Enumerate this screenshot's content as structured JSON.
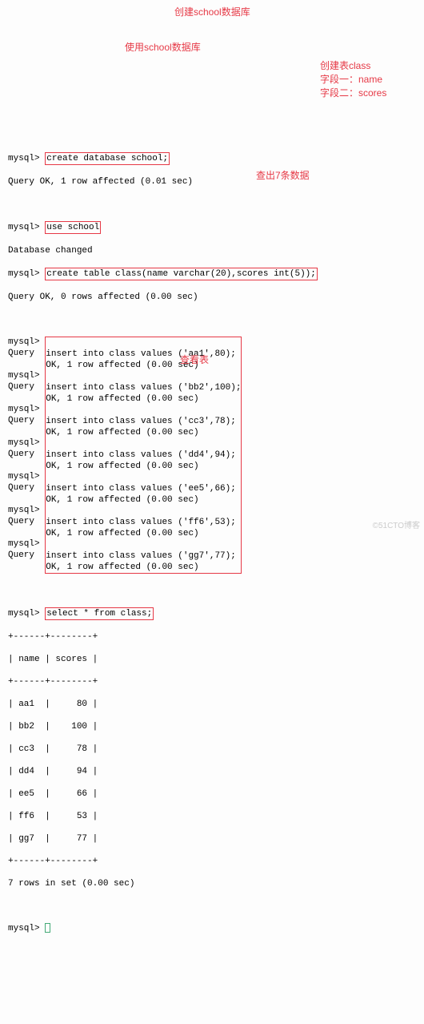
{
  "prompt": "mysql>",
  "cmd": {
    "create_db": "create database school;",
    "use_db": "use school",
    "create_table": "create table class(name varchar(20),scores int(5));",
    "select": "select * from class;"
  },
  "resp": {
    "ok_001": "Query OK, 1 row affected (0.01 sec)",
    "db_changed": "Database changed",
    "ok_0rows": "Query OK, 0 rows affected (0.00 sec)",
    "ok_000": "Query OK, 1 row affected (0.00 sec)",
    "rows_in_set": "7 rows in set (0.00 sec)"
  },
  "inserts": [
    "insert into class values ('aa1',80);",
    "insert into class values ('bb2',100);",
    "insert into class values ('cc3',78);",
    "insert into class values ('dd4',94);",
    "insert into class values ('ee5',66);",
    "insert into class values ('ff6',53);",
    "insert into class values ('gg7',77);"
  ],
  "table": {
    "sep": "+------+--------+",
    "header": "| name | scores |",
    "rows": [
      "| aa1  |     80 |",
      "| bb2  |    100 |",
      "| cc3  |     78 |",
      "| dd4  |     94 |",
      "| ee5  |     66 |",
      "| ff6  |     53 |",
      "| gg7  |     77 |"
    ]
  },
  "annotations": {
    "create_db": "创建school数据库",
    "use_db": "使用school数据库",
    "create_table": "创建表class",
    "field1": "字段一：name",
    "field2": "字段二：scores",
    "insert7": "查出7条数据",
    "select": "查看表"
  },
  "watermark": "©51CTO博客"
}
